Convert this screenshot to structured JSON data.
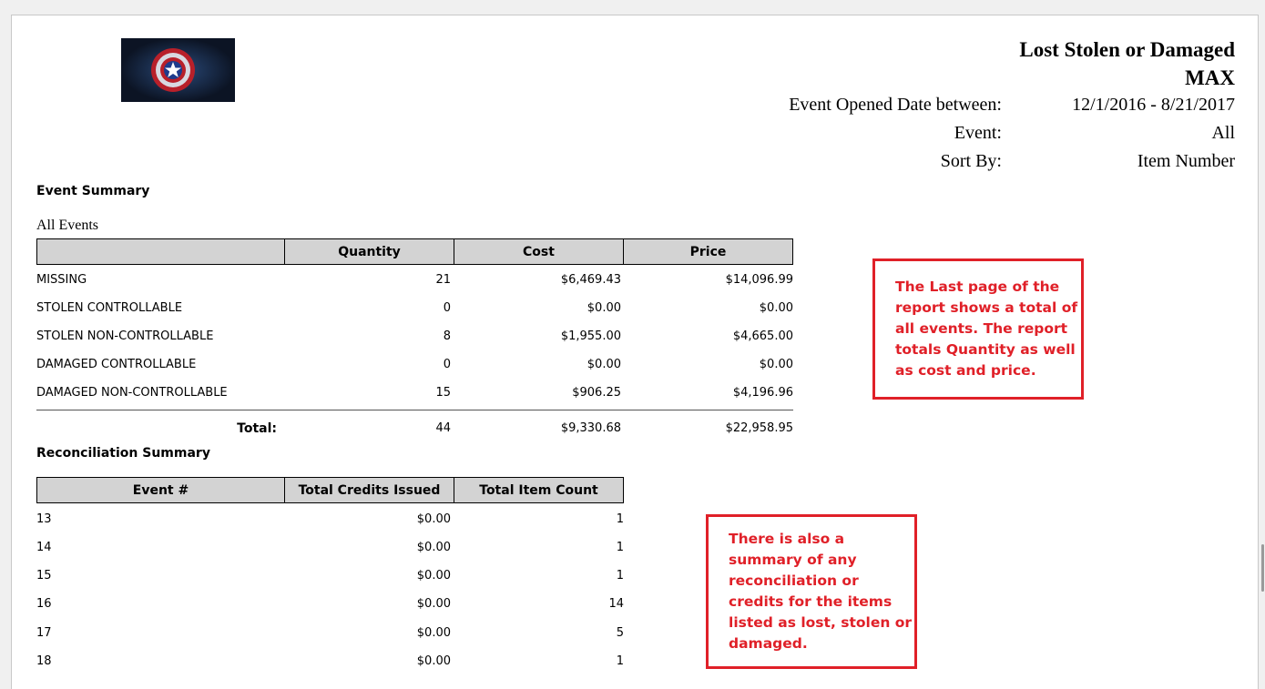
{
  "report": {
    "title_line1": "Lost Stolen or Damaged",
    "title_line2": "MAX",
    "params": [
      {
        "label": "Event Opened Date between:",
        "value": "12/1/2016 - 8/21/2017"
      },
      {
        "label": "Event:",
        "value": "All"
      },
      {
        "label": "Sort By:",
        "value": "Item Number"
      }
    ]
  },
  "event_summary": {
    "heading": "Event Summary",
    "group_label": "All Events",
    "columns": [
      "",
      "Quantity",
      "Cost",
      "Price"
    ],
    "rows": [
      {
        "name": "MISSING",
        "quantity": "21",
        "cost": "$6,469.43",
        "price": "$14,096.99"
      },
      {
        "name": "STOLEN CONTROLLABLE",
        "quantity": "0",
        "cost": "$0.00",
        "price": "$0.00"
      },
      {
        "name": "STOLEN NON-CONTROLLABLE",
        "quantity": "8",
        "cost": "$1,955.00",
        "price": "$4,665.00"
      },
      {
        "name": "DAMAGED CONTROLLABLE",
        "quantity": "0",
        "cost": "$0.00",
        "price": "$0.00"
      },
      {
        "name": "DAMAGED NON-CONTROLLABLE",
        "quantity": "15",
        "cost": "$906.25",
        "price": "$4,196.96"
      }
    ],
    "total": {
      "label": "Total:",
      "quantity": "44",
      "cost": "$9,330.68",
      "price": "$22,958.95"
    }
  },
  "reconciliation_summary": {
    "heading": "Reconciliation Summary",
    "columns": [
      "Event #",
      "Total Credits Issued",
      "Total Item Count"
    ],
    "rows": [
      {
        "event": "13",
        "credits": "$0.00",
        "count": "1"
      },
      {
        "event": "14",
        "credits": "$0.00",
        "count": "1"
      },
      {
        "event": "15",
        "credits": "$0.00",
        "count": "1"
      },
      {
        "event": "16",
        "credits": "$0.00",
        "count": "14"
      },
      {
        "event": "17",
        "credits": "$0.00",
        "count": "5"
      },
      {
        "event": "18",
        "credits": "$0.00",
        "count": "1"
      }
    ]
  },
  "callouts": {
    "totals_note": [
      "The Last page of the",
      "report shows a total of",
      "all events.  The report",
      "totals Quantity as well",
      "as cost and price."
    ],
    "reconciliation_note": [
      "There is also a",
      "summary of any",
      "reconciliation or",
      "credits for the items",
      "listed as lost, stolen or",
      "damaged."
    ]
  },
  "colors": {
    "accent_red": "#e02028",
    "header_gray": "#d3d3d3"
  },
  "icons": {
    "logo": "captain-america-shield-logo"
  }
}
